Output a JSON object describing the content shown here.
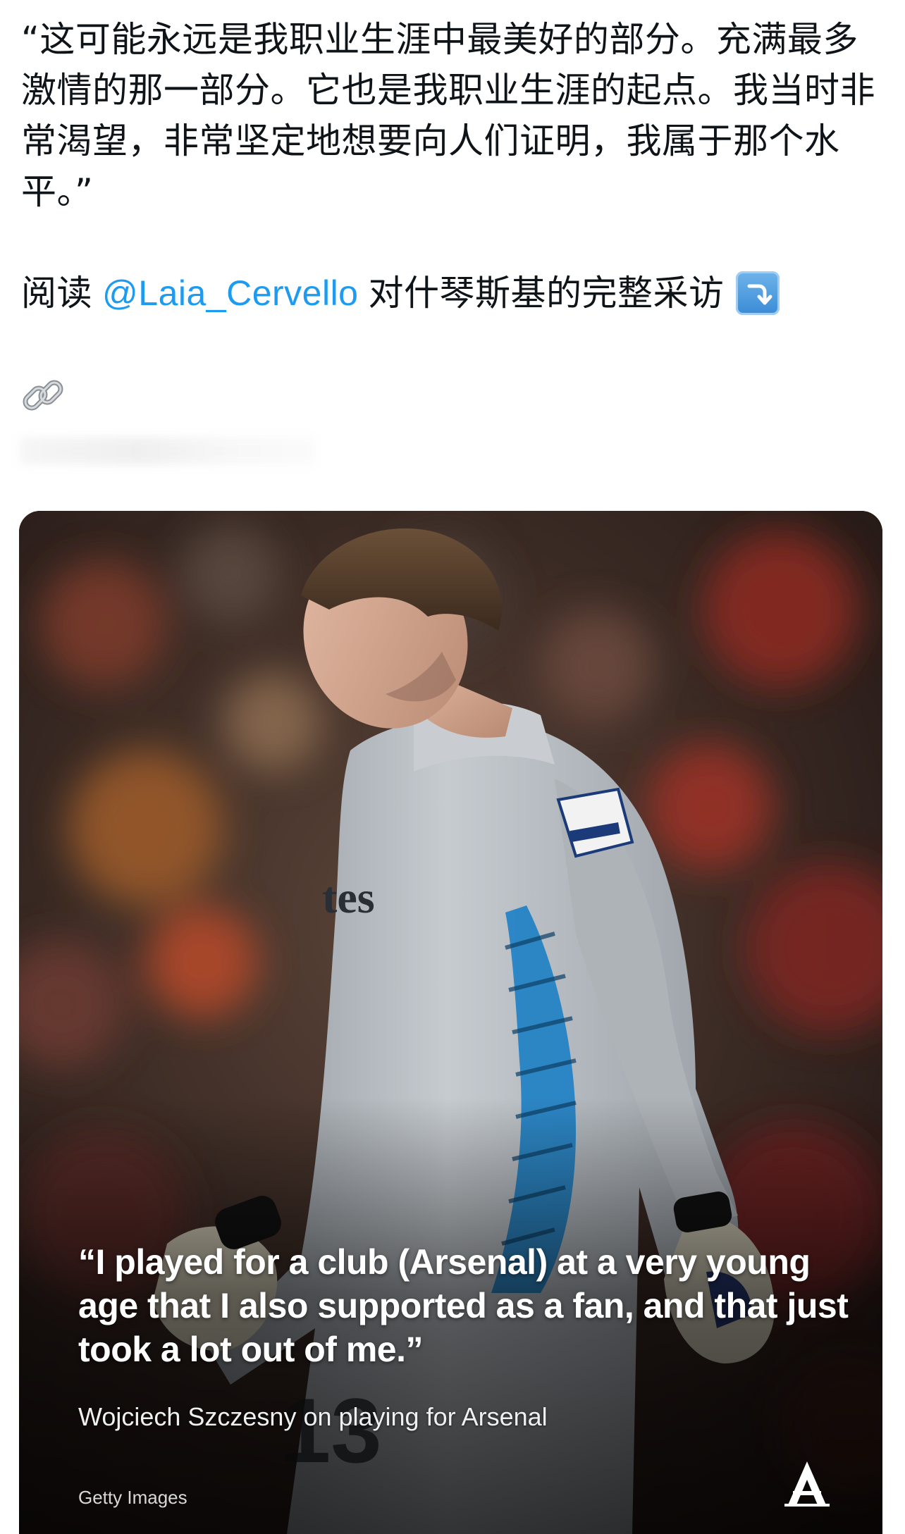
{
  "tweet": {
    "text": "“这可能永远是我职业生涯中最美好的部分。充满最多激情的那一部分。它也是我职业生涯的起点。我当时非常渴望，非常坚定地想要向人们证明，我属于那个水平。”",
    "read_prefix": "阅读",
    "mention": "@Laia_Cervello",
    "read_suffix": "对什琴斯基的完整采访",
    "arrow_emoji_icon": "arrow-curving-down-icon",
    "link_icon": "chain-link-icon"
  },
  "media": {
    "quote": "“I played for a club (Arsenal) at a very young age that I also supported as a fan, and that just took a lot out of me.”",
    "caption": "Wojciech Szczesny on playing for Arsenal",
    "credit": "Getty Images",
    "kit_number": "13",
    "sponsor_partial": "tes",
    "brand_logo": "A"
  },
  "colors": {
    "mention": "#1d9bf0",
    "text": "#0f1419",
    "kit": "#b9bec4",
    "kit_stripe": "#1d7fc4"
  }
}
